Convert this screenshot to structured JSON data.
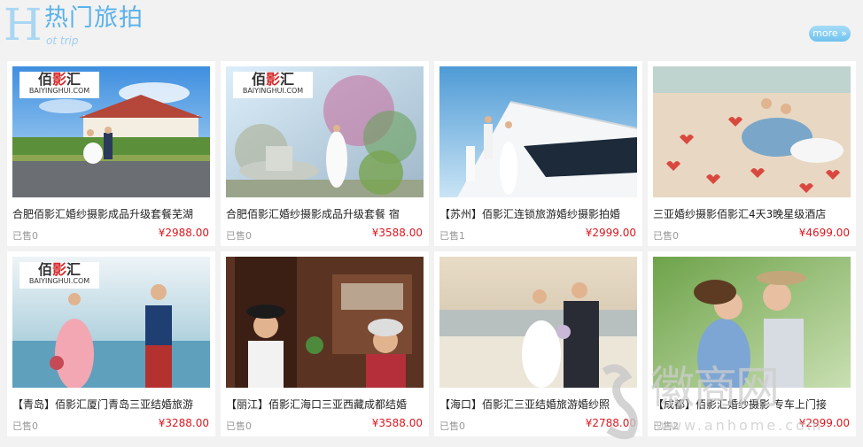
{
  "header": {
    "initial": "H",
    "title": "热门旅拍",
    "subtitle": "ot trip",
    "more_label": "more »"
  },
  "logo": {
    "brand_cn_1": "佰",
    "brand_cn_2": "影",
    "brand_cn_3": "汇",
    "brand_en": "BAIYINGHUI.COM"
  },
  "products": [
    {
      "title": "合肥佰影汇婚纱摄影成品升级套餐芜湖",
      "sold": "已售0",
      "price": "¥2988.00",
      "logo": true
    },
    {
      "title": "合肥佰影汇婚纱摄影成品升级套餐 宿",
      "sold": "已售0",
      "price": "¥3588.00",
      "logo": true
    },
    {
      "title": "【苏州】佰影汇连锁旅游婚纱摄影拍婚",
      "sold": "已售1",
      "price": "¥2999.00",
      "logo": false
    },
    {
      "title": "三亚婚纱摄影佰影汇4天3晚星级酒店",
      "sold": "已售0",
      "price": "¥4699.00",
      "logo": false
    },
    {
      "title": "【青岛】佰影汇厦门青岛三亚结婚旅游",
      "sold": "已售0",
      "price": "¥3288.00",
      "logo": true
    },
    {
      "title": "【丽江】佰影汇海口三亚西藏成都结婚",
      "sold": "已售0",
      "price": "¥3588.00",
      "logo": false
    },
    {
      "title": "【海口】佰影汇三亚结婚旅游婚纱照",
      "sold": "已售0",
      "price": "¥2788.00",
      "logo": false
    },
    {
      "title": "【成都】佰影汇婚纱摄影 专车上门接",
      "sold": "已售2",
      "price": "¥2999.00",
      "logo": false
    }
  ],
  "watermark": {
    "text": "徽商网",
    "url": "www.anhome.com"
  },
  "colors": {
    "accent": "#5ab2ea",
    "price": "#d9181f",
    "background": "#f2f2f2"
  }
}
